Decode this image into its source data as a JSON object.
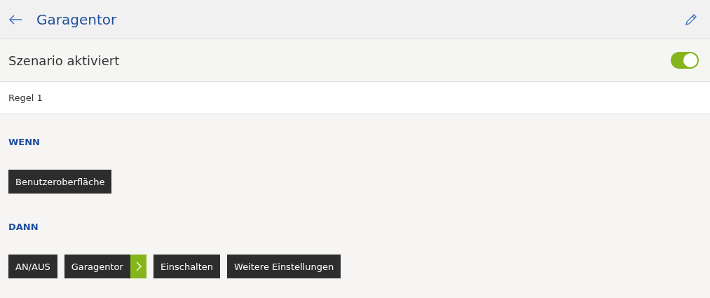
{
  "header": {
    "title": "Garagentor"
  },
  "scenario": {
    "label": "Szenario aktiviert",
    "on": true
  },
  "rule": {
    "title": "Regel 1"
  },
  "sections": [
    {
      "heading": "WENN",
      "chips": [
        {
          "label": "Benutzeroberfläche",
          "kind": "plain"
        }
      ]
    },
    {
      "heading": "DANN",
      "chips": [
        {
          "label": "AN/AUS",
          "kind": "plain"
        },
        {
          "label": "Garagentor",
          "kind": "expand"
        },
        {
          "label": "Einschalten",
          "kind": "plain"
        },
        {
          "label": "Weitere Einstellungen",
          "kind": "plain"
        }
      ]
    }
  ]
}
